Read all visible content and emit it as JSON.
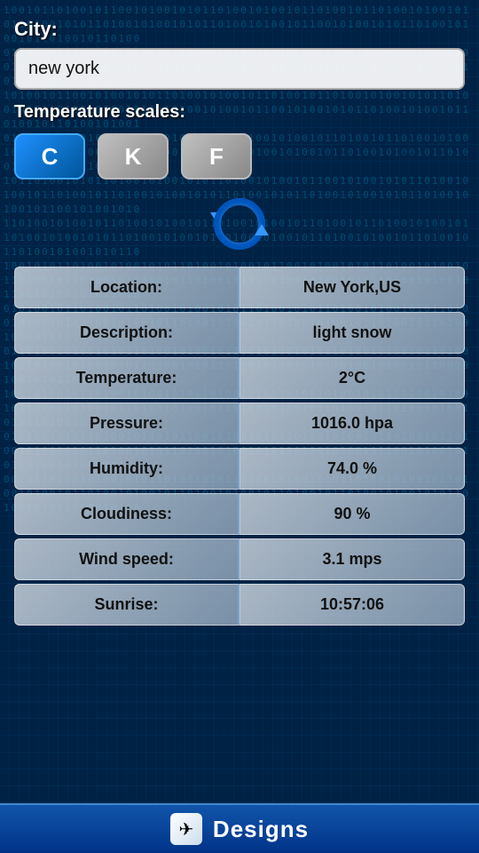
{
  "header": {
    "city_label": "City:",
    "city_value_normal": "new ",
    "city_value_underline": "york"
  },
  "temperature_scales": {
    "label": "Temperature scales:",
    "buttons": [
      {
        "key": "C",
        "label": "C",
        "active": true
      },
      {
        "key": "K",
        "label": "K",
        "active": false
      },
      {
        "key": "F",
        "label": "F",
        "active": false
      }
    ]
  },
  "weather_data": {
    "rows": [
      {
        "label": "Location:",
        "value": "New York,US"
      },
      {
        "label": "Description:",
        "value": "light snow"
      },
      {
        "label": "Temperature:",
        "value": "2°C"
      },
      {
        "label": "Pressure:",
        "value": "1016.0 hpa"
      },
      {
        "label": "Humidity:",
        "value": "74.0 %"
      },
      {
        "label": "Cloudiness:",
        "value": "90 %"
      },
      {
        "label": "Wind speed:",
        "value": "3.1 mps"
      },
      {
        "label": "Sunrise:",
        "value": "10:57:06"
      }
    ]
  },
  "footer": {
    "icon": "✈",
    "label": "Designs"
  },
  "colors": {
    "active_btn": "#1e90ff",
    "inactive_btn": "#909090",
    "background": "#002244"
  }
}
